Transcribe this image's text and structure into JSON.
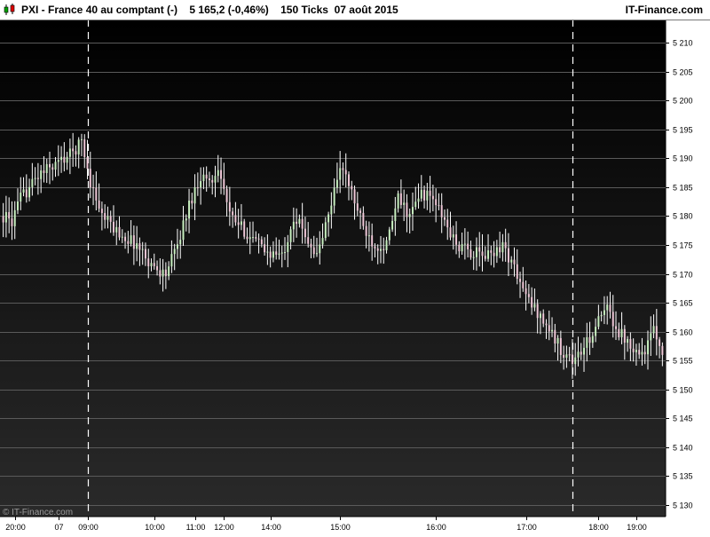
{
  "header": {
    "instrument": "PXI - France 40 au comptant (-)",
    "price": "5 165,2 (-0,46%)",
    "ticks": "150 Ticks",
    "date": "07 août 2015",
    "brand": "IT-Finance.com"
  },
  "watermark": "© IT-Finance.com",
  "colors": {
    "background_top": "#000000",
    "background_bottom": "#2a2a2a",
    "gridline": "#5a5a5a",
    "wick": "#ffffff",
    "up_candle": "#c8f0c0",
    "down_candle": "#f0c8d8",
    "session_separator": "#ffffff"
  },
  "chart_data": {
    "type": "candlestick",
    "title": "PXI - France 40 au comptant (-)",
    "xlabel": "",
    "ylabel": "",
    "ylim": [
      5128,
      5214
    ],
    "yticks": [
      5130,
      5135,
      5140,
      5145,
      5150,
      5155,
      5160,
      5165,
      5170,
      5175,
      5180,
      5185,
      5190,
      5195,
      5200,
      5205,
      5210
    ],
    "ytick_labels": [
      "5 130",
      "5 135",
      "5 140",
      "5 145",
      "5 150",
      "5 155",
      "5 160",
      "5 165",
      "5 170",
      "5 175",
      "5 180",
      "5 185",
      "5 190",
      "5 195",
      "5 200",
      "5 205",
      "5 210"
    ],
    "xtick_labels": [
      {
        "label": "20:00",
        "bar": 4
      },
      {
        "label": "07",
        "bar": 19
      },
      {
        "label": "09:00",
        "bar": 29
      },
      {
        "label": "10:00",
        "bar": 52
      },
      {
        "label": "11:00",
        "bar": 66
      },
      {
        "label": "12:00",
        "bar": 76
      },
      {
        "label": "14:00",
        "bar": 92
      },
      {
        "label": "15:00",
        "bar": 116
      },
      {
        "label": "16:00",
        "bar": 149
      },
      {
        "label": "17:00",
        "bar": 180
      },
      {
        "label": "18:00",
        "bar": 205
      },
      {
        "label": "19:00",
        "bar": 218
      }
    ],
    "session_breaks": [
      29,
      196
    ],
    "grid": true,
    "bar_count": 228,
    "path": [
      [
        0,
        5180
      ],
      [
        3,
        5179
      ],
      [
        6,
        5183
      ],
      [
        12,
        5187
      ],
      [
        18,
        5189
      ],
      [
        24,
        5191
      ],
      [
        27,
        5193
      ],
      [
        30,
        5186
      ],
      [
        34,
        5180
      ],
      [
        40,
        5177
      ],
      [
        46,
        5175
      ],
      [
        52,
        5171
      ],
      [
        56,
        5170
      ],
      [
        60,
        5175
      ],
      [
        64,
        5182
      ],
      [
        68,
        5187
      ],
      [
        72,
        5186
      ],
      [
        74,
        5189
      ],
      [
        78,
        5180
      ],
      [
        84,
        5177
      ],
      [
        90,
        5174
      ],
      [
        96,
        5173
      ],
      [
        100,
        5180
      ],
      [
        104,
        5177
      ],
      [
        108,
        5173
      ],
      [
        112,
        5180
      ],
      [
        116,
        5189
      ],
      [
        120,
        5184
      ],
      [
        124,
        5178
      ],
      [
        128,
        5175
      ],
      [
        132,
        5175
      ],
      [
        136,
        5183
      ],
      [
        140,
        5180
      ],
      [
        144,
        5184
      ],
      [
        148,
        5183
      ],
      [
        152,
        5179
      ],
      [
        156,
        5175
      ],
      [
        160,
        5174
      ],
      [
        166,
        5173
      ],
      [
        172,
        5175
      ],
      [
        176,
        5171
      ],
      [
        180,
        5166
      ],
      [
        186,
        5162
      ],
      [
        192,
        5157
      ],
      [
        196,
        5155
      ],
      [
        200,
        5157
      ],
      [
        204,
        5161
      ],
      [
        208,
        5164
      ],
      [
        212,
        5160
      ],
      [
        216,
        5158
      ],
      [
        220,
        5156
      ],
      [
        224,
        5160
      ],
      [
        227,
        5157
      ]
    ]
  }
}
